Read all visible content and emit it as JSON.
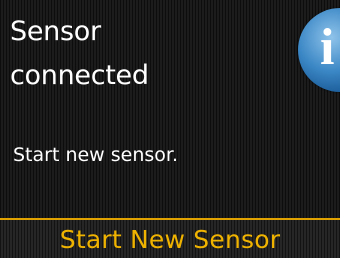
{
  "header": {
    "title": "Sensor\nconnected",
    "info_icon": "info-icon",
    "info_glyph": "i"
  },
  "body": {
    "message": "Start new sensor."
  },
  "action": {
    "label": "Start New Sensor"
  },
  "colors": {
    "background": "#1c1c1c",
    "text": "#ffffff",
    "accent": "#f0b400",
    "info_blue": "#3c88c6"
  }
}
